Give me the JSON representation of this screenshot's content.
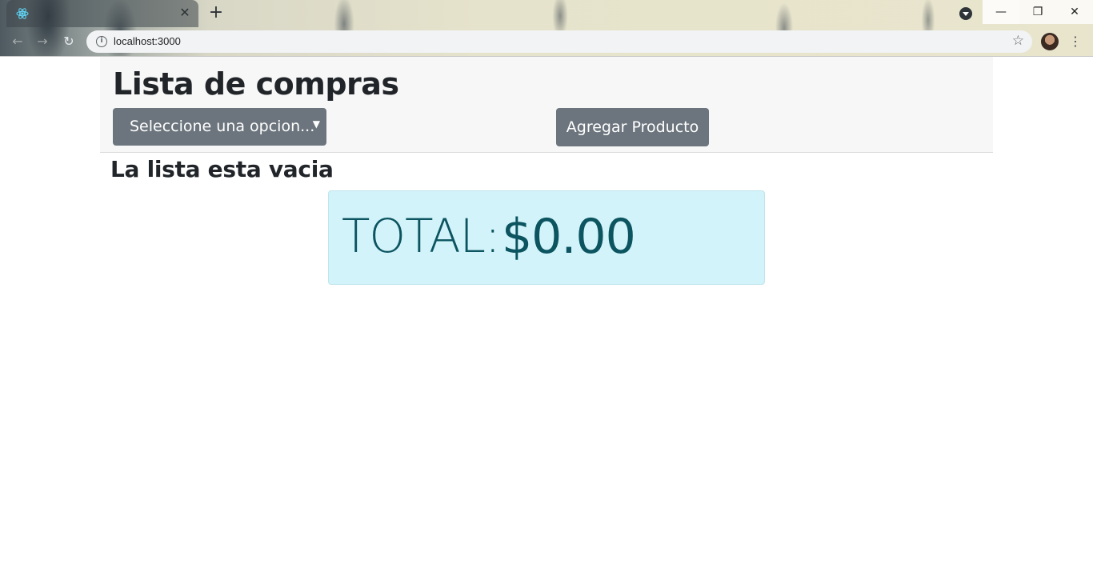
{
  "browser": {
    "tab_title": "",
    "tab_close": "✕",
    "new_tab": "+",
    "url": "localhost:3000",
    "window_controls": {
      "minimize": "—",
      "restore": "❐",
      "close": "✕"
    },
    "icons": [
      "react-favicon-icon",
      "back-icon",
      "forward-icon",
      "reload-icon",
      "info-icon",
      "star-icon",
      "menu-icon"
    ]
  },
  "app": {
    "title": "Lista de compras",
    "select": {
      "value": "Seleccione una opcion..."
    },
    "add_button_label": "Agregar Producto",
    "empty_message": "La lista esta vacia",
    "total": {
      "label": "TOTAL:",
      "value": "$0.00"
    }
  },
  "colors": {
    "button_bg": "#6c757d",
    "total_bg": "#d1f3f9",
    "total_text": "#0c5460",
    "header_bg": "#f7f7f7"
  }
}
